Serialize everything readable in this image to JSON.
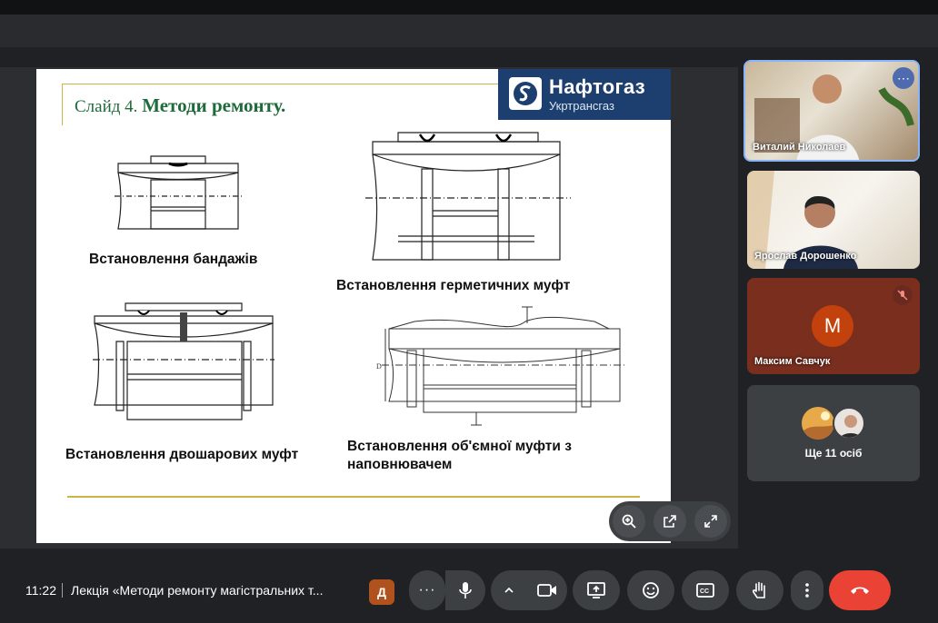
{
  "slide": {
    "title_prefix": "Слайд 4.",
    "title_main": "Методи ремонту.",
    "logo_name": "Нафтогаз",
    "logo_sub": "Укртрансгаз",
    "captions": [
      "Встановлення бандажів",
      "Встановлення герметичних муфт",
      "Встановлення двошарових муфт",
      "Встановлення об'ємної муфти з",
      "наповнювачем"
    ]
  },
  "participants": [
    {
      "name": "Виталий Николаев"
    },
    {
      "name": "Ярослав Дорошенко"
    },
    {
      "name": "Максим Савчук",
      "initial": "M",
      "color": "#c2410c"
    }
  ],
  "others": {
    "label": "Ще 11 осіб"
  },
  "bottombar": {
    "time": "11:22",
    "meeting_title": "Лекція «Методи ремонту магістральних т...",
    "host_badge": "Д"
  },
  "icons": [
    "zoom-in-icon",
    "open-in-new-icon",
    "expand-icon",
    "more-icon",
    "mic-icon",
    "chevron-up-icon",
    "camera-icon",
    "present-icon",
    "emoji-icon",
    "captions-icon",
    "hand-icon",
    "more-vert-icon",
    "hangup-icon",
    "mic-off-icon"
  ],
  "colors": {
    "accent_green": "#1d6b3a",
    "logo_blue": "#1c3f70",
    "hangup": "#ea4335",
    "avatar": "#c2410c"
  }
}
